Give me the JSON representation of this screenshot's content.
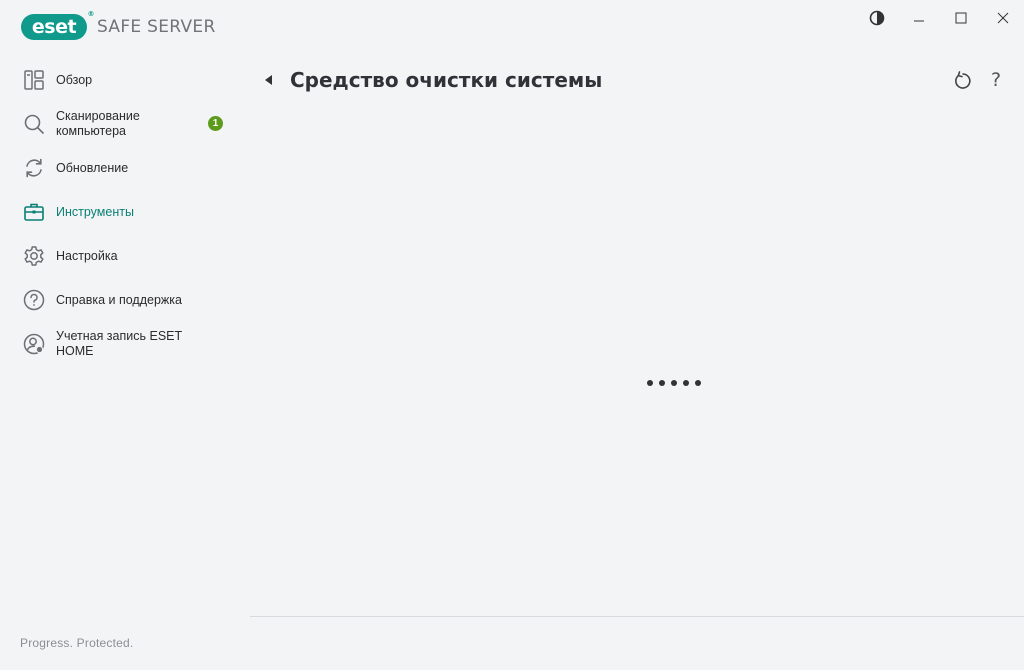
{
  "app": {
    "brand": "eset",
    "product": "SAFE SERVER",
    "trademark": "®",
    "accent_color": "#0f9a8b"
  },
  "window_controls": {
    "contrast_icon": "contrast-icon",
    "minimize_icon": "minimize-icon",
    "maximize_icon": "maximize-icon",
    "close_icon": "close-icon"
  },
  "sidebar": {
    "items": [
      {
        "label": "Обзор",
        "icon": "overview-icon"
      },
      {
        "label": "Сканирование компьютера",
        "icon": "search-icon",
        "badge": "1"
      },
      {
        "label": "Обновление",
        "icon": "update-icon"
      },
      {
        "label": "Инструменты",
        "icon": "toolbox-icon",
        "active": true
      },
      {
        "label": "Настройка",
        "icon": "gear-icon"
      },
      {
        "label": "Справка и поддержка",
        "icon": "help-circle-icon"
      },
      {
        "label": "Учетная запись ESET HOME",
        "icon": "account-icon"
      }
    ],
    "badge_color": "#5d9b1b",
    "tagline": "Progress. Protected."
  },
  "main": {
    "title": "Средство очистки системы",
    "back_icon": "back-arrow-icon",
    "refresh_icon": "refresh-icon",
    "help_label": "?",
    "loading_dots": 5
  }
}
